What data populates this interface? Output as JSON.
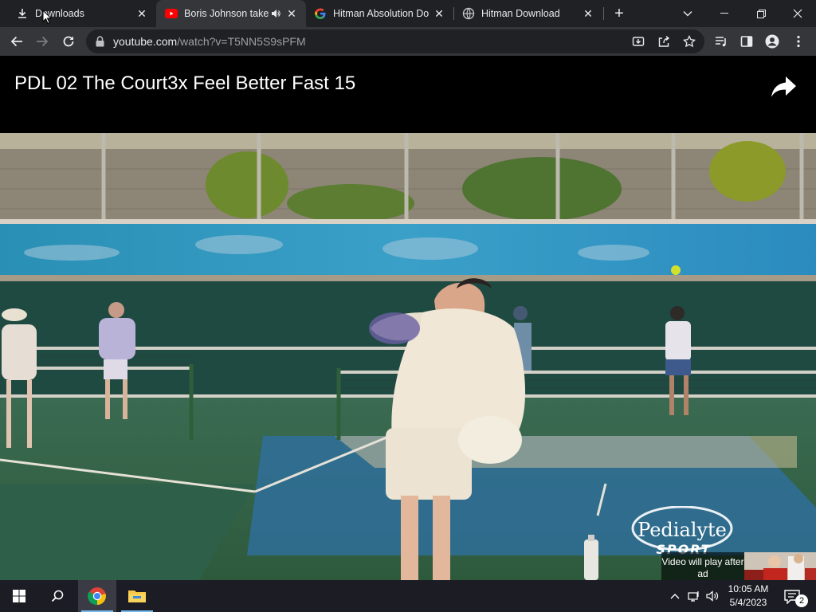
{
  "browser": {
    "tabs": [
      {
        "title": "Downloads",
        "icon": "download-icon",
        "active": false
      },
      {
        "title": "Boris Johnson take",
        "icon": "youtube-icon",
        "active": true,
        "audio": true
      },
      {
        "title": "Hitman Absolution Do",
        "icon": "google-icon",
        "active": false
      },
      {
        "title": "Hitman Download",
        "icon": "globe-icon",
        "active": false
      }
    ],
    "address": {
      "host": "youtube.com",
      "path": "/watch?v=T5NN5S9sPFM"
    }
  },
  "video": {
    "title": "PDL 02 The Court3x Feel Better Fast 15",
    "ad_notice": "Video will play after ad",
    "brand_logo": "Pedialyte SPORT"
  },
  "taskbar": {
    "time": "10:05 AM",
    "date": "5/4/2023",
    "notification_count": "2"
  },
  "colors": {
    "tabstrip_bg": "#202124",
    "toolbar_bg": "#35363a",
    "page_bg": "#000000",
    "taskbar_bg": "#1b1c24",
    "youtube_red": "#ff0000"
  }
}
